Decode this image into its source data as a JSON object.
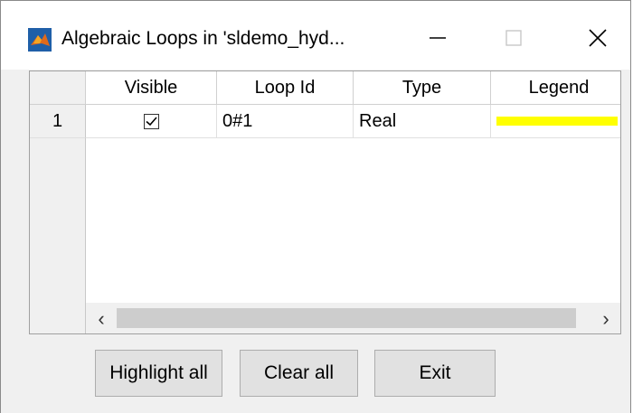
{
  "window": {
    "title": "Algebraic Loops in 'sldemo_hyd..."
  },
  "controls": {
    "minimize_icon": "minimize-icon",
    "maximize_icon": "maximize-icon",
    "close_icon": "close-icon"
  },
  "table": {
    "columns": [
      "Visible",
      "Loop Id",
      "Type",
      "Legend"
    ],
    "rows": [
      {
        "row_number": "1",
        "visible": true,
        "loop_id": "0#1",
        "type": "Real",
        "legend_color": "#ffff00"
      }
    ],
    "scroll_left_glyph": "‹",
    "scroll_right_glyph": "›"
  },
  "buttons": {
    "highlight_all": "Highlight all",
    "clear_all": "Clear all",
    "exit": "Exit"
  },
  "colors": {
    "legend_yellow": "#ffff00",
    "app_icon_orange": "#e06a1b",
    "app_icon_blue": "#1f5fa8"
  }
}
